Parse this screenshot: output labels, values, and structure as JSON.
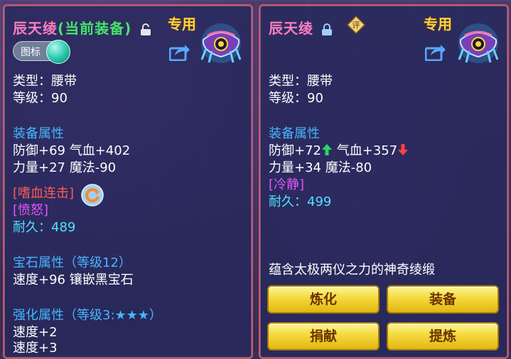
{
  "left": {
    "title_name": "辰天绫",
    "title_equipped": "(当前装备)",
    "exclusive": "专用",
    "icon_toggle_label": "图标",
    "type_line": "类型：腰带",
    "level_line": "等级：90",
    "equip_attr_header": "装备属性",
    "attr_line1": "防御+69 气血+402",
    "attr_line2": "力量+27 魔法-90",
    "special1": "[嗜血连击]",
    "special2": "[愤怒]",
    "durability": "耐久：489",
    "gem_header": "宝石属性（等级12）",
    "gem_line": "速度+96 镶嵌黑宝石",
    "enhance_header": "强化属性（等级3:★★★）",
    "enhance_line1": "速度+2",
    "enhance_line2": "速度+3"
  },
  "right": {
    "title_name": "辰天绫",
    "exclusive": "专用",
    "type_line": "类型：腰带",
    "level_line": "等级：90",
    "equip_attr_header": "装备属性",
    "attr_def": "防御+72",
    "attr_hp": "气血+357",
    "attr_line2": "力量+34 魔法-80",
    "special1": "[冷静]",
    "durability": "耐久：499",
    "description": "蕴含太极两仪之力的神奇绫缎",
    "buttons": {
      "refine": "炼化",
      "equip": "装备",
      "donate": "捐献",
      "extract": "提炼"
    }
  },
  "icons": [
    "unlock-icon",
    "lock-icon",
    "evaluate-icon",
    "share-icon",
    "item-belt-icon",
    "refresh-skill-icon",
    "arrow-up-icon",
    "arrow-down-icon"
  ],
  "colors": {
    "name": "#ff7ec0",
    "equipped": "#47e36a",
    "exclusive": "#ffd23c",
    "section_header": "#46b6ff",
    "durability": "#4fe3ff",
    "special_red": "#ff5a5a",
    "special_magenta": "#e056ff",
    "button": "#f4d93b"
  }
}
